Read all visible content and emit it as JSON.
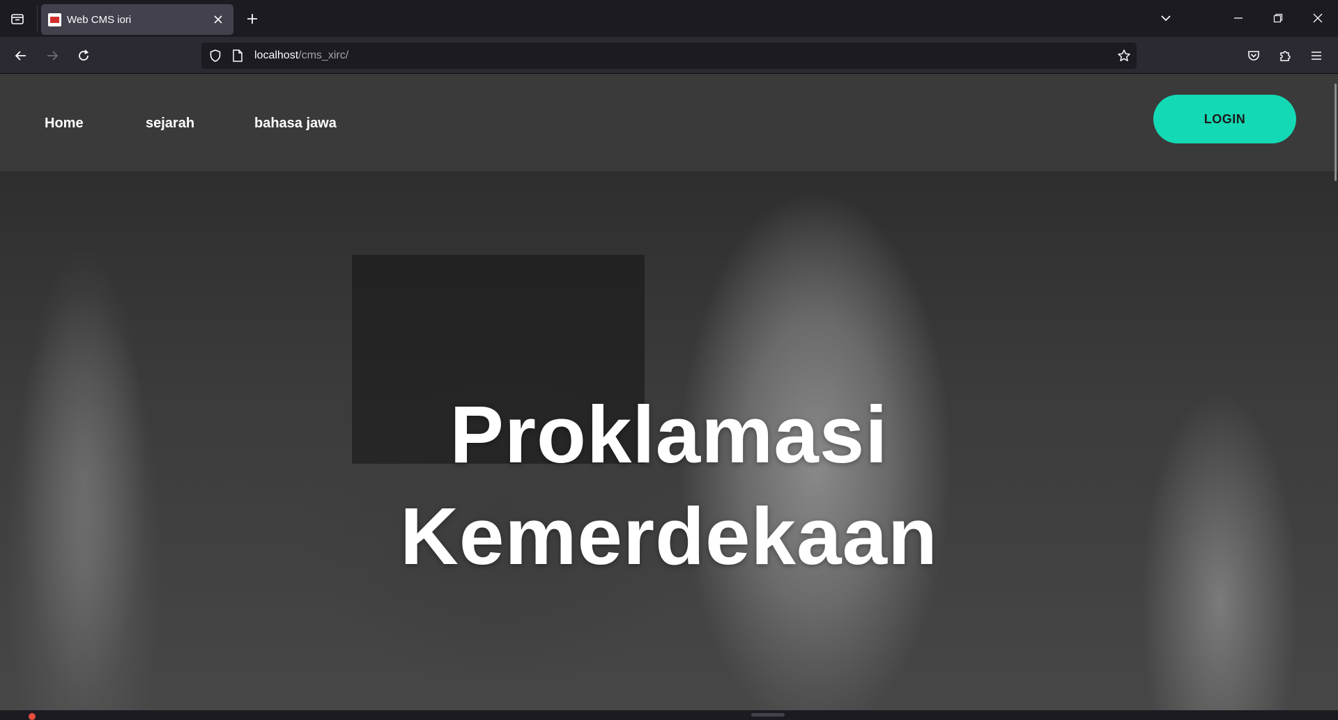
{
  "browser": {
    "tab_title": "Web CMS iori",
    "url_host": "localhost",
    "url_path": "/cms_xirc/"
  },
  "site": {
    "nav_items": [
      "Home",
      "sejarah",
      "bahasa jawa"
    ],
    "login_label": "LOGIN",
    "hero_line1": "Proklamasi",
    "hero_line2": "Kemerdekaan"
  },
  "colors": {
    "accent": "#14d9b5",
    "header_bg": "#3a3a3a",
    "chrome_bg": "#1c1b22"
  },
  "icons": {
    "tab_list": "tab-list-icon",
    "new_tab": "plus-icon",
    "back": "back-arrow-icon",
    "forward": "forward-arrow-icon",
    "reload": "reload-icon",
    "shield": "shield-icon",
    "page": "page-icon",
    "bookmark": "star-icon",
    "pocket": "pocket-icon",
    "extensions": "puzzle-icon",
    "menu": "hamburger-icon"
  }
}
